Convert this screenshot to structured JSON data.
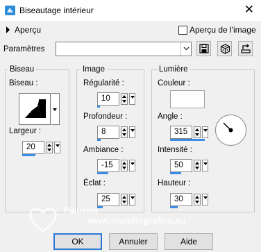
{
  "window": {
    "title": "Biseautage intérieur",
    "close_icon": "close-icon"
  },
  "preview": {
    "toggle_label": "Aperçu",
    "checkbox_label": "Aperçu de l'image",
    "checked": false
  },
  "presets": {
    "label": "Paramètres",
    "value": ""
  },
  "bevel": {
    "group_title": "Biseau",
    "shape_label": "Biseau :",
    "width_label": "Largeur :",
    "width_value": "20"
  },
  "image": {
    "group_title": "Image",
    "smoothness_label": "Régularité :",
    "smoothness_value": "10",
    "depth_label": "Profondeur :",
    "depth_value": "8",
    "ambience_label": "Ambiance :",
    "ambience_value": "-15",
    "shininess_label": "Éclat :",
    "shininess_value": "25"
  },
  "light": {
    "group_title": "Lumière",
    "color_label": "Couleur :",
    "color_value": "#ffffff",
    "angle_label": "Angle :",
    "angle_value": "315",
    "intensity_label": "Intensité :",
    "intensity_value": "50",
    "elevation_label": "Hauteur :",
    "elevation_value": "30"
  },
  "buttons": {
    "ok": "OK",
    "cancel": "Annuler",
    "help": "Aide"
  },
  "watermark": {
    "name": "Pinuccia",
    "url": "www.mundiografica.eu"
  }
}
